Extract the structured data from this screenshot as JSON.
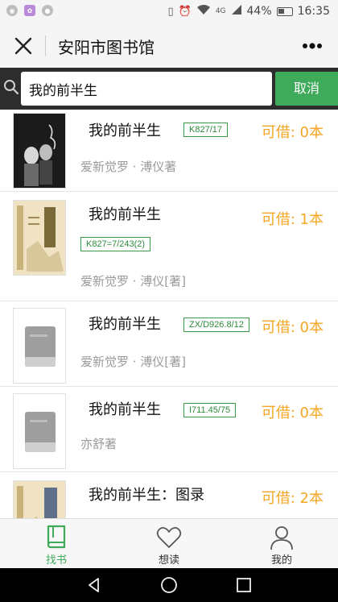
{
  "status_bar": {
    "network_label": "4G",
    "battery": "44%",
    "time": "16:35"
  },
  "header": {
    "title": "安阳市图书馆"
  },
  "search": {
    "value": "我的前半生",
    "cancel_label": "取消"
  },
  "books": [
    {
      "title": "我的前半生",
      "call_number": "K827/17",
      "availability": "可借: 0本",
      "author": "爱新觉罗 · 溥仪著",
      "cover": "photo"
    },
    {
      "title": "我的前半生",
      "call_number": "K827=7/243(2)",
      "availability": "可借: 1本",
      "author": "爱新觉罗 · 溥仪[著]",
      "cover": "beige"
    },
    {
      "title": "我的前半生",
      "call_number": "ZX/D926.8/12",
      "availability": "可借: 0本",
      "author": "爱新觉罗 · 溥仪[著]",
      "cover": "placeholder"
    },
    {
      "title": "我的前半生",
      "call_number": "I711.45/75",
      "availability": "可借: 0本",
      "author": "亦舒著",
      "cover": "placeholder"
    },
    {
      "title": "我的前半生：图录",
      "call_number": "",
      "availability": "可借: 2本",
      "author": "",
      "cover": "beige"
    }
  ],
  "tabs": [
    {
      "label": "找书",
      "icon": "book-icon",
      "active": true
    },
    {
      "label": "想读",
      "icon": "heart-icon",
      "active": false
    },
    {
      "label": "我的",
      "icon": "person-icon",
      "active": false
    }
  ],
  "colors": {
    "accent": "#3faa5a",
    "availability": "#f5a623",
    "search_bar_bg": "#2d2d2d"
  }
}
